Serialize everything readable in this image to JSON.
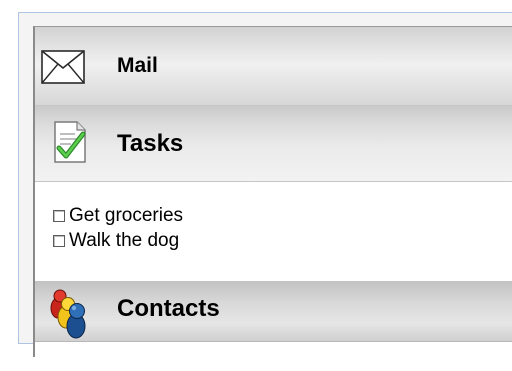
{
  "sections": [
    {
      "id": "mail",
      "label": "Mail",
      "icon": "envelope-icon"
    },
    {
      "id": "tasks",
      "label": "Tasks",
      "icon": "checked-document-icon"
    },
    {
      "id": "contacts",
      "label": "Contacts",
      "icon": "people-icon"
    }
  ],
  "tasks": {
    "items": [
      {
        "label": "Get groceries",
        "checked": false
      },
      {
        "label": "Walk the dog",
        "checked": false
      }
    ]
  },
  "colors": {
    "frame_border": "#aec4e0",
    "header_gradient_light": "#f0f0f0",
    "header_gradient_dark": "#d2d2d2",
    "check_green": "#3aa336"
  }
}
